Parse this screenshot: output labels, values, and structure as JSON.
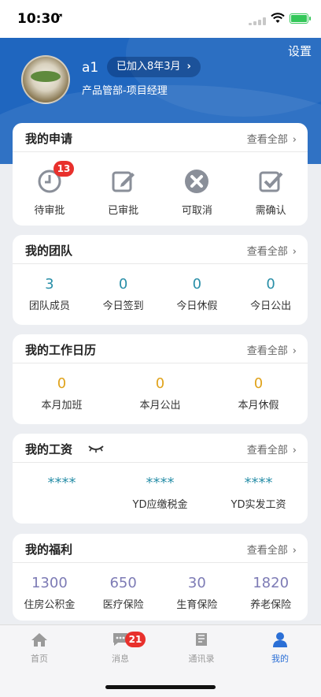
{
  "status_bar": {
    "time": "10:30",
    "location_glyph": "➚"
  },
  "header": {
    "settings_label": "设置",
    "user_name": "a1",
    "joined_label": "已加入8年3月",
    "department": "产品管部-项目经理"
  },
  "applications": {
    "title": "我的申请",
    "view_all": "查看全部",
    "items": [
      {
        "label": "待审批",
        "icon": "clock-icon",
        "badge": "13"
      },
      {
        "label": "已审批",
        "icon": "edit-icon"
      },
      {
        "label": "可取消",
        "icon": "cancel-icon"
      },
      {
        "label": "需确认",
        "icon": "check-icon"
      }
    ]
  },
  "team": {
    "title": "我的团队",
    "view_all": "查看全部",
    "items": [
      {
        "value": "3",
        "label": "团队成员"
      },
      {
        "value": "0",
        "label": "今日签到"
      },
      {
        "value": "0",
        "label": "今日休假"
      },
      {
        "value": "0",
        "label": "今日公出"
      }
    ]
  },
  "calendar": {
    "title": "我的工作日历",
    "view_all": "查看全部",
    "items": [
      {
        "value": "0",
        "label": "本月加班"
      },
      {
        "value": "0",
        "label": "本月公出"
      },
      {
        "value": "0",
        "label": "本月休假"
      }
    ]
  },
  "salary": {
    "title": "我的工资",
    "view_all": "查看全部",
    "items": [
      {
        "value": "****",
        "label": ""
      },
      {
        "value": "****",
        "label": "YD应缴税金"
      },
      {
        "value": "****",
        "label": "YD实发工资"
      }
    ]
  },
  "welfare": {
    "title": "我的福利",
    "view_all": "查看全部",
    "items": [
      {
        "value": "1300",
        "label": "住房公积金"
      },
      {
        "value": "650",
        "label": "医疗保险"
      },
      {
        "value": "30",
        "label": "生育保险"
      },
      {
        "value": "1820",
        "label": "养老保险"
      }
    ]
  },
  "tabbar": {
    "items": [
      {
        "label": "首页",
        "icon": "home-icon"
      },
      {
        "label": "消息",
        "icon": "message-icon",
        "badge": "21"
      },
      {
        "label": "通讯录",
        "icon": "book-icon"
      },
      {
        "label": "我的",
        "icon": "person-icon",
        "active": true
      }
    ]
  },
  "colors": {
    "header_blue": "#1f66bf",
    "team_number": "#2a8fa8",
    "calendar_number": "#e0a31c",
    "welfare_number": "#7d7bb5",
    "icon_gray": "#8a8f99",
    "badge_red": "#e8302c",
    "active_tab": "#2b6fd6"
  }
}
